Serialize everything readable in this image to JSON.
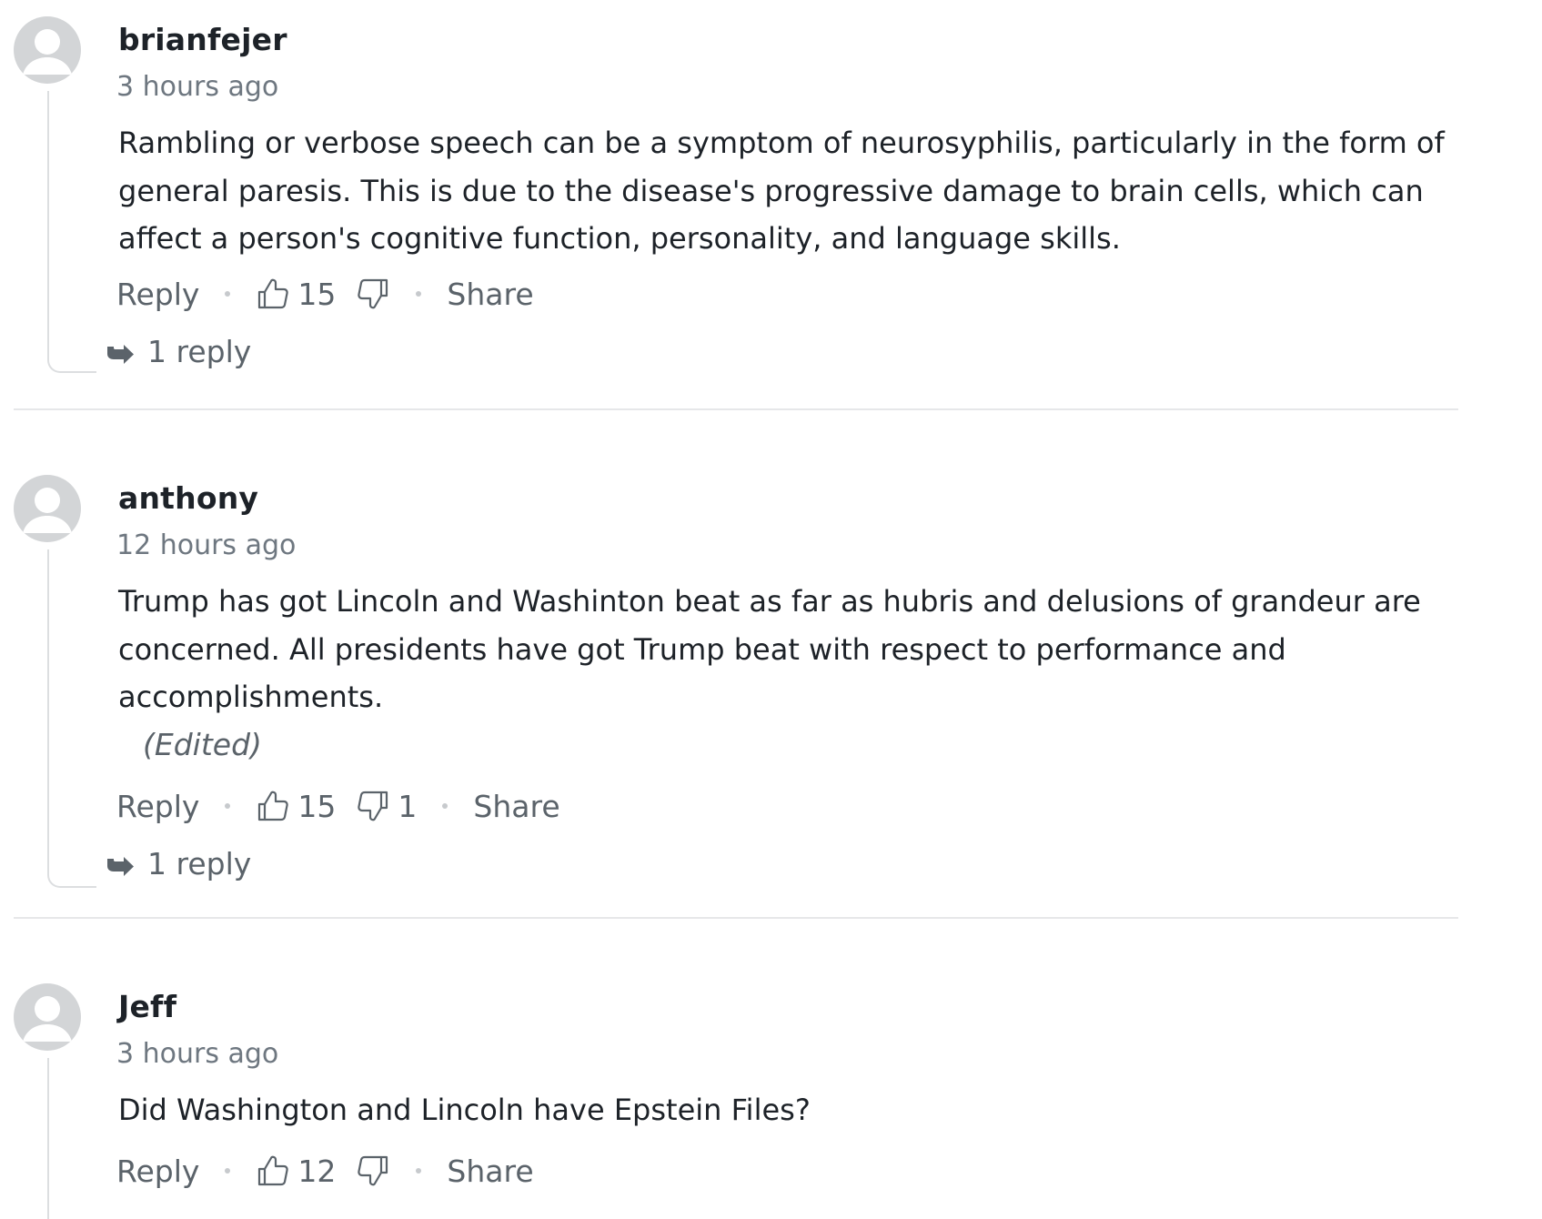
{
  "colors": {
    "text_primary": "#1d2228",
    "text_secondary": "#5b636a",
    "timestamp": "#6e7780",
    "avatar_bg": "#d3d5d7",
    "divider": "#e6e7e9"
  },
  "comments": [
    {
      "username": "brianfejer",
      "timestamp": "3 hours ago",
      "body": "Rambling or verbose speech can be a symptom of neurosyphilis, particularly in the form of general paresis. This is due to the disease's progressive damage to brain cells, which can affect a person's cognitive function, personality, and language skills.",
      "edited_label": "",
      "reply_label": "Reply",
      "likes": "15",
      "dislikes": "",
      "share_label": "Share",
      "replies_label": "1 reply"
    },
    {
      "username": "anthony",
      "timestamp": "12 hours ago",
      "body": "Trump has got Lincoln and Washinton beat as far as hubris and delusions of grandeur are concerned. All presidents have got Trump beat with respect to performance and accomplishments.",
      "edited_label": "(Edited)",
      "reply_label": "Reply",
      "likes": "15",
      "dislikes": "1",
      "share_label": "Share",
      "replies_label": "1 reply"
    },
    {
      "username": "Jeff",
      "timestamp": "3 hours ago",
      "body": "Did Washington and Lincoln have Epstein Files?",
      "edited_label": "",
      "reply_label": "Reply",
      "likes": "12",
      "dislikes": "",
      "share_label": "Share",
      "replies_label": ""
    }
  ],
  "icons": {
    "avatar": "default-user-avatar-icon",
    "like": "thumbs-up-icon",
    "dislike": "thumbs-down-icon",
    "replies": "reply-arrow-icon"
  }
}
